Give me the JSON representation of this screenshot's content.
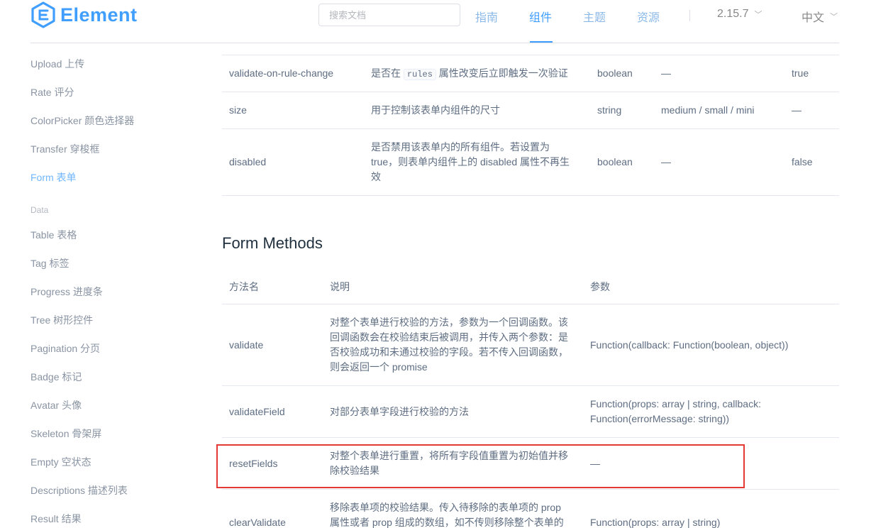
{
  "header": {
    "logo_text": "Element",
    "search_placeholder": "搜索文档",
    "nav": [
      "指南",
      "组件",
      "主题",
      "资源"
    ],
    "version": "2.15.7",
    "language": "中文",
    "accent_color": "#409eff"
  },
  "sidebar": {
    "items_top": [
      "Upload 上传",
      "Rate 评分",
      "ColorPicker 颜色选择器",
      "Transfer 穿梭框",
      "Form 表单"
    ],
    "group": "Data",
    "items_data": [
      "Table 表格",
      "Tag 标签",
      "Progress 进度条",
      "Tree 树形控件",
      "Pagination 分页",
      "Badge 标记",
      "Avatar 头像",
      "Skeleton 骨架屏",
      "Empty 空状态",
      "Descriptions 描述列表",
      "Result 结果"
    ]
  },
  "attributes_table": {
    "rows": [
      {
        "name": "validate-on-rule-change",
        "desc_pre": "是否在",
        "desc_code": "rules",
        "desc_post": "属性改变后立即触发一次验证",
        "type": "boolean",
        "options": "—",
        "default": "true"
      },
      {
        "name": "size",
        "desc": "用于控制该表单内组件的尺寸",
        "type": "string",
        "options": "medium / small / mini",
        "default": "—"
      },
      {
        "name": "disabled",
        "desc_lines": [
          "是否禁用该表单内的所有组件。若设置为",
          "true，则表单内组件上的 disabled 属性不再生",
          "效"
        ],
        "type": "boolean",
        "options": "—",
        "default": "false"
      }
    ]
  },
  "methods": {
    "title": "Form Methods",
    "headers": [
      "方法名",
      "说明",
      "参数"
    ],
    "rows": [
      {
        "name": "validate",
        "desc_lines": [
          "对整个表单进行校验的方法，参数为一个回调函数。该",
          "回调函数会在校验结束后被调用，并传入两个参数：是",
          "否校验成功和未通过校验的字段。若不传入回调函数，",
          "则会返回一个 promise"
        ],
        "params_lines": [
          "Function(callback: Function(boolean, object))"
        ]
      },
      {
        "name": "validateField",
        "desc_lines": [
          "对部分表单字段进行校验的方法"
        ],
        "params_lines": [
          "Function(props: array | string, callback:",
          "Function(errorMessage: string))"
        ]
      },
      {
        "name": "resetFields",
        "desc_lines": [
          "对整个表单进行重置，将所有字段值重置为初始值并移",
          "除校验结果"
        ],
        "params_lines": [
          "—"
        ]
      },
      {
        "name": "clearValidate",
        "desc_lines": [
          "移除表单项的校验结果。传入待移除的表单项的 prop",
          "属性或者 prop 组成的数组，如不传则移除整个表单的"
        ],
        "params_lines": [
          "Function(props: array | string)"
        ]
      }
    ]
  }
}
